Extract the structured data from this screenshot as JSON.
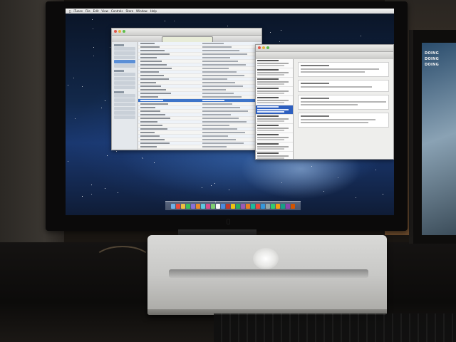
{
  "scene": {
    "description_colors": {
      "wallpaper_top": "#0a1426",
      "wallpaper_glow": "#aac8eb",
      "laptop_body": "#d9d9d7",
      "desk": "#151312"
    }
  },
  "menubar": {
    "apple": "",
    "items": [
      "iTunes",
      "File",
      "Edit",
      "View",
      "Controls",
      "Store",
      "Window",
      "Help"
    ],
    "clock": ""
  },
  "itunes_window": {
    "title": "",
    "lcd_text": ""
  },
  "mail_window": {
    "title": ""
  },
  "side_monitor": {
    "labels": [
      "DOING",
      "DOING",
      "DOING"
    ]
  },
  "dock": {
    "icon_colors": [
      "#6fb1e8",
      "#e84c3d",
      "#f0c040",
      "#3cbf5a",
      "#8a6fd8",
      "#e98a2a",
      "#5cc8e0",
      "#d94f8a",
      "#7dd070",
      "#f5f5f5",
      "#4a8be0",
      "#c0392b",
      "#f1c40f",
      "#27ae60",
      "#9b59b6",
      "#e67e22",
      "#1abc9c",
      "#e74c3c",
      "#3498db",
      "#95a5a6",
      "#2ecc71",
      "#f39c12",
      "#16a085",
      "#8e44ad",
      "#d35400"
    ]
  }
}
